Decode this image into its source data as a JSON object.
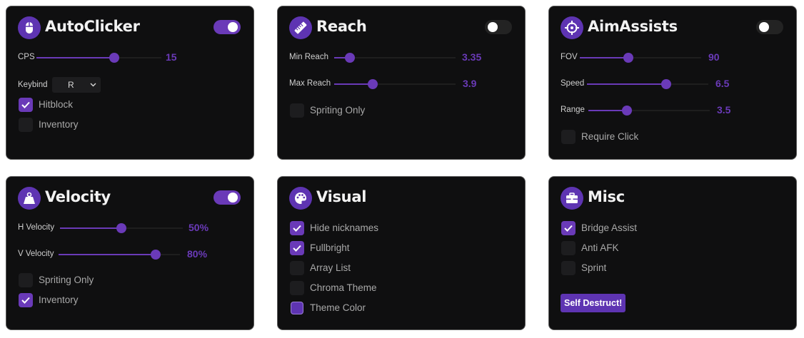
{
  "autoclicker": {
    "title": "AutoClicker",
    "enabled": true,
    "cps_label": "CPS",
    "cps_value": "15",
    "cps_fraction": 0.62,
    "keybind_label": "Keybind",
    "keybind_value": "R",
    "hitblock_label": "Hitblock",
    "hitblock_checked": true,
    "inventory_label": "Inventory",
    "inventory_checked": false
  },
  "reach": {
    "title": "Reach",
    "enabled": false,
    "min_label": "Min Reach",
    "min_value": "3.35",
    "min_fraction": 0.13,
    "max_label": "Max Reach",
    "max_value": "3.9",
    "max_fraction": 0.32,
    "spriting_label": "Spriting Only",
    "spriting_checked": false
  },
  "aimassists": {
    "title": "AimAssists",
    "enabled": false,
    "fov_label": "FOV",
    "fov_value": "90",
    "fov_fraction": 0.4,
    "speed_label": "Speed",
    "speed_value": "6.5",
    "speed_fraction": 0.65,
    "range_label": "Range",
    "range_value": "3.5",
    "range_fraction": 0.32,
    "require_label": "Require Click",
    "require_checked": false
  },
  "velocity": {
    "title": "Velocity",
    "enabled": true,
    "h_label": "H Velocity",
    "h_value": "50%",
    "h_fraction": 0.5,
    "v_label": "V Velocity",
    "v_value": "80%",
    "v_fraction": 0.8,
    "spriting_label": "Spriting Only",
    "spriting_checked": false,
    "inventory_label": "Inventory",
    "inventory_checked": true
  },
  "visual": {
    "title": "Visual",
    "hide_label": "Hide nicknames",
    "hide_checked": true,
    "fullbright_label": "Fullbright",
    "fullbright_checked": true,
    "arraylist_label": "Array List",
    "arraylist_checked": false,
    "chroma_label": "Chroma Theme",
    "chroma_checked": false,
    "themecolor_label": "Theme Color",
    "themecolor_hex": "#5e34b2"
  },
  "misc": {
    "title": "Misc",
    "bridge_label": "Bridge Assist",
    "bridge_checked": true,
    "antiafk_label": "Anti AFK",
    "antiafk_checked": false,
    "sprint_label": "Sprint",
    "sprint_checked": false,
    "self_destruct_label": "Self Destruct!"
  },
  "colors": {
    "accent": "#6a3ab8",
    "card_bg": "#0f0f10",
    "border": "#5a5a5a",
    "icon_bg": "#5e34b2"
  },
  "icons": {
    "autoclicker": "mouse-icon",
    "reach": "ruler-icon",
    "aimassists": "crosshair-icon",
    "velocity": "weight-icon",
    "visual": "palette-icon",
    "misc": "toolbox-icon"
  }
}
